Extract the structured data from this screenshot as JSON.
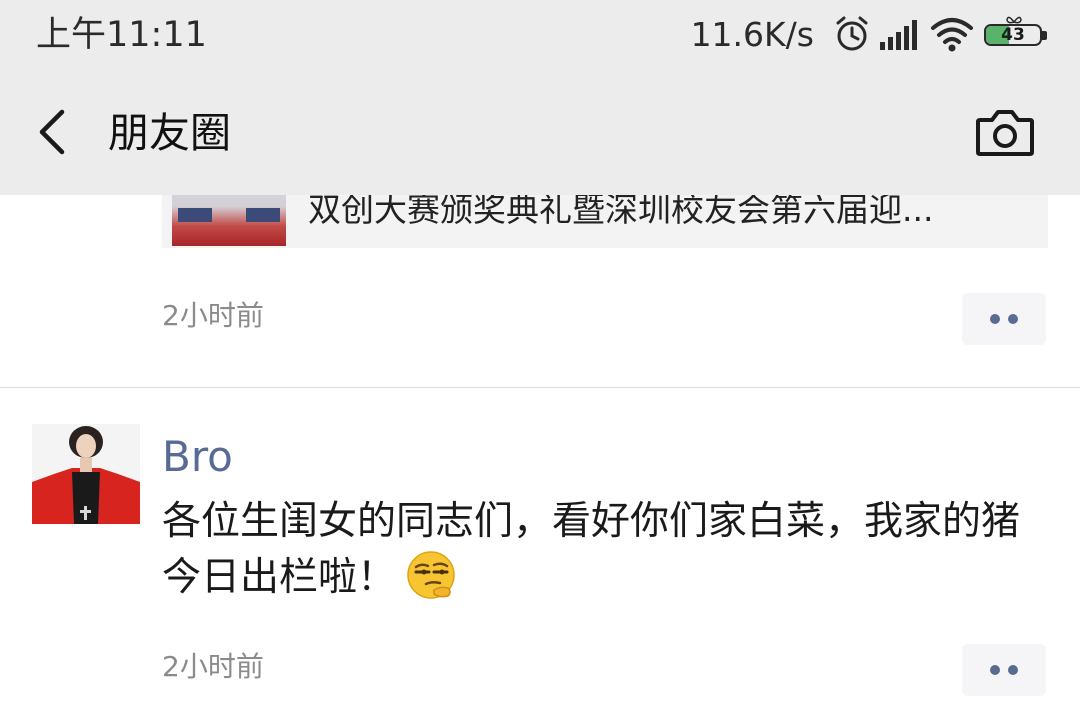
{
  "status_bar": {
    "time": "上午11:11",
    "net_speed": "11.6K/s",
    "battery_level": "43",
    "battery_fill_percent": 43,
    "icons": [
      "alarm-icon",
      "signal-icon",
      "wifi-icon",
      "battery-icon"
    ]
  },
  "nav": {
    "title": "朋友圈",
    "back_icon": "chevron-left-icon",
    "camera_icon": "camera-icon"
  },
  "posts": [
    {
      "link_title": "双创大赛颁奖典礼暨深圳校友会第六届迎...",
      "time": "2小时前",
      "more_icon": "more-dots-icon"
    },
    {
      "author": "Bro",
      "text": "各位生闺女的同志们，看好你们家白菜，我家的猪今日出栏啦！",
      "emoji": "smirk-emoji-icon",
      "time": "2小时前",
      "more_icon": "more-dots-icon"
    }
  ],
  "colors": {
    "header_bg": "#ececec",
    "author_name": "#576b95",
    "timestamp": "#8b8b8b",
    "battery_fill": "#5ab36a"
  }
}
